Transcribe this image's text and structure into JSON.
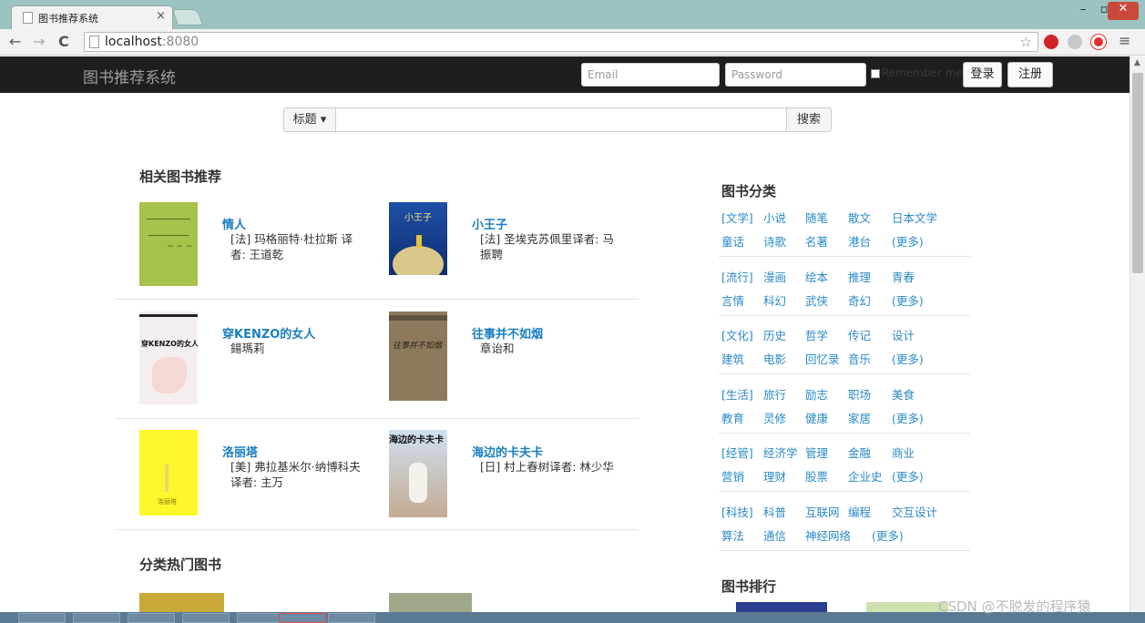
{
  "browser": {
    "tab_title": "图书推荐系统",
    "tab_close": "×",
    "url_host": "localhost",
    "url_port": ":8080",
    "win_min": "–",
    "win_max": "▫",
    "win_close": "✕"
  },
  "navbar": {
    "brand": "图书推荐系统",
    "email_placeholder": "Email",
    "password_placeholder": "Password",
    "remember_label": "Remember me",
    "login_label": "登录",
    "register_label": "注册"
  },
  "search": {
    "dropdown_label": "标题 ▾",
    "button_label": "搜索"
  },
  "related": {
    "title": "相关图书推荐",
    "books": [
      {
        "title": "情人",
        "author": "[法] 玛格丽特·杜拉斯 译者: 王道乾"
      },
      {
        "title": "小王子",
        "author": "[法] 圣埃克苏佩里译者: 马振聘"
      },
      {
        "title": "穿KENZO的女人",
        "author": "鍚瑪莉"
      },
      {
        "title": "往事并不如烟",
        "author": "章诒和"
      },
      {
        "title": "洛丽塔",
        "author": "[美] 弗拉基米尔·纳博科夫 译者: 主万"
      },
      {
        "title": "海边的卡夫卡",
        "author": "[日] 村上春树译者: 林少华"
      }
    ]
  },
  "hot": {
    "title": "分类热门图书"
  },
  "categories": {
    "title": "图书分类",
    "groups": [
      {
        "row1": [
          "[文学]",
          "小说",
          "随笔",
          "散文",
          "日本文学"
        ],
        "row2": [
          "童话",
          "诗歌",
          "名著",
          "港台",
          "(更多)"
        ]
      },
      {
        "row1": [
          "[流行]",
          "漫画",
          "绘本",
          "推理",
          "青春"
        ],
        "row2": [
          "言情",
          "科幻",
          "武侠",
          "奇幻",
          "(更多)"
        ]
      },
      {
        "row1": [
          "[文化]",
          "历史",
          "哲学",
          "传记",
          "设计"
        ],
        "row2": [
          "建筑",
          "电影",
          "回忆录",
          "音乐",
          "(更多)"
        ]
      },
      {
        "row1": [
          "[生活]",
          "旅行",
          "励志",
          "职场",
          "美食"
        ],
        "row2": [
          "教育",
          "灵修",
          "健康",
          "家居",
          "(更多)"
        ]
      },
      {
        "row1": [
          "[经管]",
          "经济学",
          "管理",
          "金融",
          "商业"
        ],
        "row2": [
          "营销",
          "理财",
          "股票",
          "企业史",
          "(更多)"
        ]
      },
      {
        "row1": [
          "[科技]",
          "科普",
          "互联网",
          "编程",
          "交互设计"
        ],
        "row2": [
          "算法",
          "通信",
          "神经网络",
          "(更多)"
        ]
      }
    ]
  },
  "ranking": {
    "title": "图书排行"
  },
  "watermark": "CSDN @不脱发的程序猿"
}
